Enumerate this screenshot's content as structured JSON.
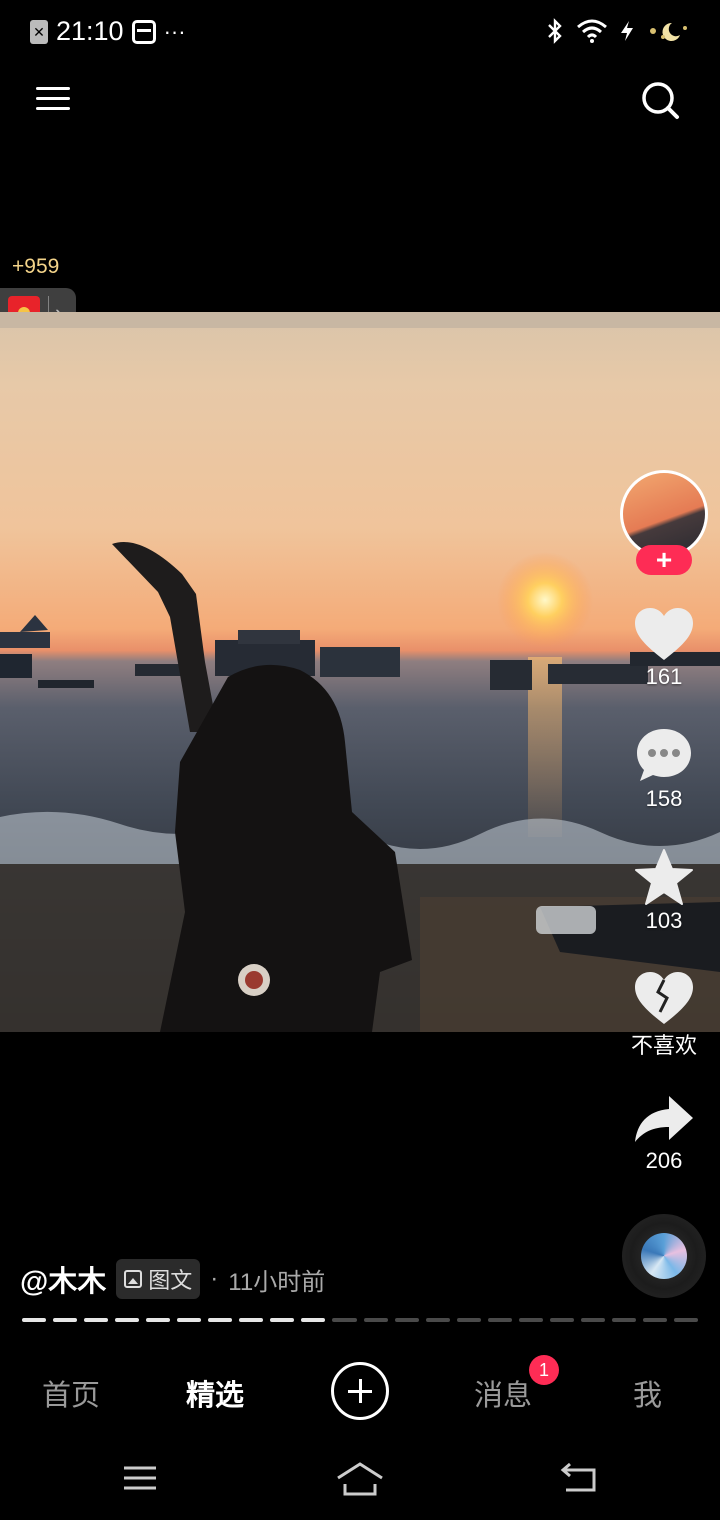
{
  "status_bar": {
    "time": "21:10",
    "more_dots": "···",
    "right_icons": [
      "bluetooth-icon",
      "wifi-icon",
      "charging-icon",
      "moon-icon"
    ]
  },
  "header": {
    "menu_icon": "menu-icon",
    "search_icon": "search-icon"
  },
  "reward": {
    "count": "+959",
    "chevron": "›"
  },
  "actions": {
    "follow_label": "+",
    "like_count": "161",
    "comment_count": "158",
    "favorite_count": "103",
    "dislike_label": "不喜欢",
    "share_count": "206"
  },
  "post": {
    "author": "@木木",
    "tag": "图文",
    "separator": "·",
    "time_ago": "11小时前",
    "progress": {
      "total_pages": 22,
      "current_page": 10
    }
  },
  "bottom_nav": {
    "home": "首页",
    "featured": "精选",
    "messages": "消息",
    "messages_badge": "1",
    "me": "我"
  },
  "colors": {
    "accent": "#fe2c55",
    "background": "#000000",
    "reward_gold": "#f4d48a"
  }
}
